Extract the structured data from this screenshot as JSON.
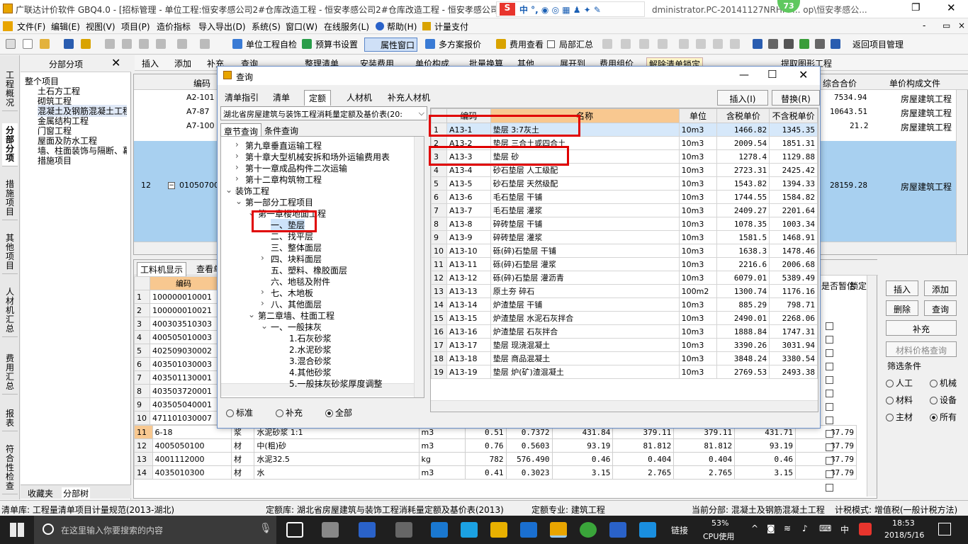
{
  "window": {
    "title": "广联达计价软件 GBQ4.0 - [招标管理 - 单位工程:恒安孝感公司2#仓库改造工程 - 恒安孝感公司2#仓库改造工程 - 恒安孝感公司",
    "title_right": "dministrator.PC-20141127NRHM ... op\\恒安孝感公...",
    "ime_badge": "73"
  },
  "menu": [
    "文件(F)",
    "编辑(E)",
    "视图(V)",
    "项目(P)",
    "造价指标",
    "导入导出(D)",
    "系统(S)",
    "窗口(W)",
    "在线服务(L)",
    "帮助(H)",
    "计量支付"
  ],
  "toolbar": {
    "self_check": "单位工程自检",
    "budget_set": "预算书设置",
    "prop_window": "属性窗口",
    "multi_plan": "多方案报价",
    "fee_view": "费用查看",
    "local_summary": "局部汇总",
    "return_mgmt": "返回项目管理"
  },
  "toolbar2": [
    "插入",
    "添加",
    "补充",
    "查询",
    "整理清单",
    "安装费用",
    "单价构成",
    "批量换算",
    "其他",
    "展开到",
    "费用组价",
    "解除清单锁定",
    "提取图形工程"
  ],
  "vtabs": [
    "工程概况",
    "分部分项",
    "措施项目",
    "其他项目",
    "人材机汇总",
    "费用汇总",
    "报表",
    "符合性检查"
  ],
  "left_panel": {
    "header": "分部分项",
    "root": "整个项目",
    "items": [
      "土石方工程",
      "砌筑工程",
      "混凝土及钢筋混凝土工程",
      "金属结构工程",
      "门窗工程",
      "屋面及防水工程",
      "墙、柱面装饰与隔断、幕",
      "措施项目"
    ],
    "bottom_tabs": [
      "收藏夹",
      "分部树"
    ]
  },
  "main_grid": {
    "col_code": "编码",
    "col_total": "综合合价",
    "col_file": "单价构成文件",
    "rows": [
      {
        "code": "A2-101",
        "total": "7534.94",
        "file": "房屋建筑工程"
      },
      {
        "code": "A7-87",
        "total": "10643.51",
        "file": "房屋建筑工程"
      },
      {
        "code": "A7-100",
        "total": "21.2",
        "file": "房屋建筑工程"
      },
      {
        "num": "12",
        "code": "010507001",
        "total": "28159.28",
        "file": "房屋建筑工程"
      }
    ]
  },
  "lower_grid": {
    "tab": "工料机显示",
    "tab2": "查看单",
    "col_code": "编码",
    "rows": [
      {
        "n": "1",
        "code": "100000010001"
      },
      {
        "n": "2",
        "code": "100000010021"
      },
      {
        "n": "3",
        "code": "400303510303"
      },
      {
        "n": "4",
        "code": "400505010003"
      },
      {
        "n": "5",
        "code": "402509030002"
      },
      {
        "n": "6",
        "code": "403501030003"
      },
      {
        "n": "7",
        "code": "403501130001"
      },
      {
        "n": "8",
        "code": "403503720001"
      },
      {
        "n": "9",
        "code": "403505040001"
      },
      {
        "n": "10",
        "code": "471101030007"
      }
    ],
    "detail_rows": [
      {
        "n": "11",
        "code": "6-18",
        "type": "浆",
        "name": "水泥砂浆 1:1",
        "unit": "m3",
        "q1": "0.51",
        "q2": "0.7372",
        "p1": "431.84",
        "p2": "379.11",
        "p3": "379.11",
        "p4": "431.71",
        "p5": "87.79"
      },
      {
        "n": "12",
        "code": "4005050100",
        "type": "材",
        "name": "中(粗)砂",
        "unit": "m3",
        "q1": "0.76",
        "q2": "0.5603",
        "p1": "93.19",
        "p2": "81.812",
        "p3": "81.812",
        "p4": "93.19",
        "p5": "87.79"
      },
      {
        "n": "13",
        "code": "4001112000",
        "type": "材",
        "name": "水泥32.5",
        "unit": "kg",
        "q1": "782",
        "q2": "576.490",
        "p1": "0.46",
        "p2": "0.404",
        "p3": "0.404",
        "p4": "0.46",
        "p5": "87.79"
      },
      {
        "n": "14",
        "code": "4035010300",
        "type": "材",
        "name": "水",
        "unit": "m3",
        "q1": "0.41",
        "q2": "0.3023",
        "p1": "3.15",
        "p2": "2.765",
        "p3": "2.765",
        "p4": "3.15",
        "p5": "87.79"
      }
    ],
    "col_temp": "是否暂估",
    "col_lock": "锁定"
  },
  "right_panel": {
    "insert": "插入",
    "add": "添加",
    "delete": "删除",
    "query": "查询",
    "supplement": "补充",
    "price_query": "材料价格查询",
    "filter_label": "筛选条件",
    "filters": [
      "人工",
      "机械",
      "材料",
      "设备",
      "主材",
      "所有"
    ]
  },
  "dialog": {
    "title": "查询",
    "tabs": [
      "清单指引",
      "清单",
      "定额",
      "人材机",
      "补充人材机"
    ],
    "insert_btn": "插入(I)",
    "replace_btn": "替换(R)",
    "library": "湖北省房屋建筑与装饰工程消耗量定额及基价表(20:",
    "sub_tabs": [
      "章节查询",
      "条件查询"
    ],
    "tree": [
      "第九章垂直运输工程",
      "第十章大型机械安拆和场外运输费用表",
      "第十一章成品构件二次运输",
      "第十二章构筑物工程",
      "装饰工程",
      "第一部分工程项目",
      "第一章楼地面工程",
      "一、垫层",
      "二、找平层",
      "三、整体面层",
      "四、块料面层",
      "五、塑料、橡胶面层",
      "六、地毯及附件",
      "七、木地板",
      "八、其他面层",
      "第二章墙、柱面工程",
      "一、一般抹灰",
      "1.石灰砂浆",
      "2.水泥砂浆",
      "3.混合砂浆",
      "4.其他砂浆",
      "5.一般抹灰砂浆厚度调整"
    ],
    "radios": [
      "标准",
      "补充",
      "全部"
    ],
    "table_headers": [
      "编码",
      "名称",
      "单位",
      "含税单价",
      "不含税单价"
    ],
    "rows": [
      {
        "n": "1",
        "code": "A13-1",
        "name": "垫层 3:7灰土",
        "unit": "10m3",
        "tax": "1466.82",
        "notax": "1345.35"
      },
      {
        "n": "2",
        "code": "A13-2",
        "name": "垫层 三合土或四合土",
        "unit": "10m3",
        "tax": "2009.54",
        "notax": "1851.31"
      },
      {
        "n": "3",
        "code": "A13-3",
        "name": "垫层 砂",
        "unit": "10m3",
        "tax": "1278.4",
        "notax": "1129.88"
      },
      {
        "n": "4",
        "code": "A13-4",
        "name": "砂石垫层 人工级配",
        "unit": "10m3",
        "tax": "2723.31",
        "notax": "2425.42"
      },
      {
        "n": "5",
        "code": "A13-5",
        "name": "砂石垫层 天然级配",
        "unit": "10m3",
        "tax": "1543.82",
        "notax": "1394.33"
      },
      {
        "n": "6",
        "code": "A13-6",
        "name": "毛石垫层 干铺",
        "unit": "10m3",
        "tax": "1744.55",
        "notax": "1584.82"
      },
      {
        "n": "7",
        "code": "A13-7",
        "name": "毛石垫层 灌浆",
        "unit": "10m3",
        "tax": "2409.27",
        "notax": "2201.64"
      },
      {
        "n": "8",
        "code": "A13-8",
        "name": "碎砖垫层 干铺",
        "unit": "10m3",
        "tax": "1078.35",
        "notax": "1003.34"
      },
      {
        "n": "9",
        "code": "A13-9",
        "name": "碎砖垫层 灌浆",
        "unit": "10m3",
        "tax": "1581.5",
        "notax": "1468.91"
      },
      {
        "n": "10",
        "code": "A13-10",
        "name": "砾(碎)石垫层 干铺",
        "unit": "10m3",
        "tax": "1638.3",
        "notax": "1478.46"
      },
      {
        "n": "11",
        "code": "A13-11",
        "name": "砾(碎)石垫层 灌浆",
        "unit": "10m3",
        "tax": "2216.6",
        "notax": "2006.68"
      },
      {
        "n": "12",
        "code": "A13-12",
        "name": "砾(碎)石垫层 灌沥青",
        "unit": "10m3",
        "tax": "6079.01",
        "notax": "5389.49"
      },
      {
        "n": "13",
        "code": "A13-13",
        "name": "原土夯 碎石",
        "unit": "100m2",
        "tax": "1300.74",
        "notax": "1176.16"
      },
      {
        "n": "14",
        "code": "A13-14",
        "name": "炉渣垫层 干铺",
        "unit": "10m3",
        "tax": "885.29",
        "notax": "798.71"
      },
      {
        "n": "15",
        "code": "A13-15",
        "name": "炉渣垫层 水泥石灰拌合",
        "unit": "10m3",
        "tax": "2490.01",
        "notax": "2268.06"
      },
      {
        "n": "16",
        "code": "A13-16",
        "name": "炉渣垫层 石灰拌合",
        "unit": "10m3",
        "tax": "1888.84",
        "notax": "1747.31"
      },
      {
        "n": "17",
        "code": "A13-17",
        "name": "垫层 现浇混凝土",
        "unit": "10m3",
        "tax": "3390.26",
        "notax": "3031.94"
      },
      {
        "n": "18",
        "code": "A13-18",
        "name": "垫层 商品混凝土",
        "unit": "10m3",
        "tax": "3848.24",
        "notax": "3380.54"
      },
      {
        "n": "19",
        "code": "A13-19",
        "name": "垫层 炉(矿)渣混凝土",
        "unit": "10m3",
        "tax": "2769.53",
        "notax": "2493.38"
      }
    ]
  },
  "status": {
    "list_lib": "清单库: 工程量清单项目计量规范(2013-湖北)",
    "quota_lib": "定额库: 湖北省房屋建筑与装饰工程消耗量定额及基价表(2013)",
    "quota_major": "定额专业: 建筑工程",
    "current": "当前分部: 混凝土及钢筋混凝土工程",
    "tax_mode": "计税模式: 增值税(一般计税方法)"
  },
  "taskbar": {
    "search": "在这里输入你要搜索的内容",
    "link": "链接",
    "cpu_pct": "53%",
    "cpu_label": "CPU使用",
    "ime": "中",
    "time": "18:53",
    "date": "2018/5/16"
  }
}
